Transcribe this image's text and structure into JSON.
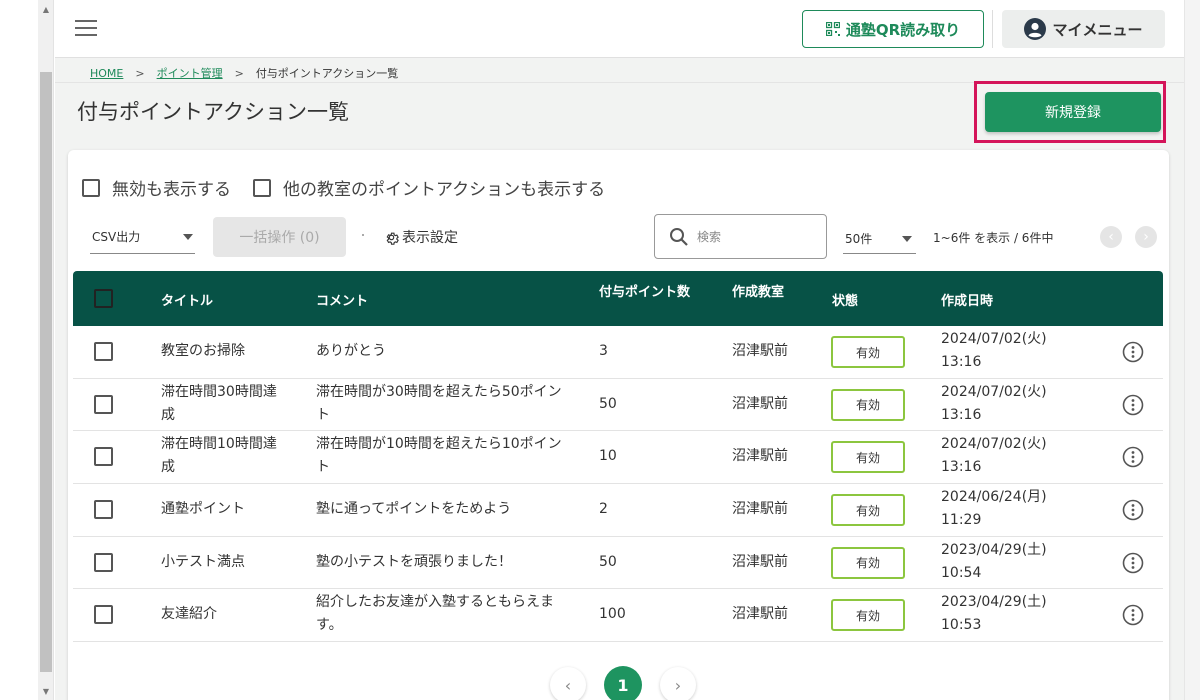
{
  "header": {
    "qr_button": "通塾QR読み取り",
    "mymenu_button": "マイメニュー"
  },
  "breadcrumb": {
    "home": "HOME",
    "sep1": ">",
    "points": "ポイント管理",
    "sep2": ">",
    "current": "付与ポイントアクション一覧"
  },
  "page": {
    "title": "付与ポイントアクション一覧",
    "new_button": "新規登録"
  },
  "filters": {
    "show_disabled": "無効も表示する",
    "show_other_classrooms": "他の教室のポイントアクションも表示する"
  },
  "toolbar": {
    "csv_label": "CSV出力",
    "bulk_label": "一括操作 (0)",
    "display_settings": "表示設定",
    "search_placeholder": "検索",
    "perpage": "50件",
    "count_text": "1~6件 を表示 / 6件中"
  },
  "table": {
    "headers": {
      "title": "タイトル",
      "comment": "コメント",
      "points": "付与ポイント数",
      "classroom": "作成教室",
      "status": "状態",
      "created": "作成日時"
    },
    "rows": [
      {
        "title": "教室のお掃除",
        "comment": "ありがとう",
        "points": "3",
        "classroom": "沼津駅前",
        "status": "有効",
        "date": "2024/07/02(火)",
        "time": "13:16"
      },
      {
        "title": "滞在時間30時間達成",
        "comment": "滞在時間が30時間を超えたら50ポイント",
        "points": "50",
        "classroom": "沼津駅前",
        "status": "有効",
        "date": "2024/07/02(火)",
        "time": "13:16"
      },
      {
        "title": "滞在時間10時間達成",
        "comment": "滞在時間が10時間を超えたら10ポイント",
        "points": "10",
        "classroom": "沼津駅前",
        "status": "有効",
        "date": "2024/07/02(火)",
        "time": "13:16"
      },
      {
        "title": "通塾ポイント",
        "comment": "塾に通ってポイントをためよう",
        "points": "2",
        "classroom": "沼津駅前",
        "status": "有効",
        "date": "2024/06/24(月)",
        "time": "11:29"
      },
      {
        "title": "小テスト満点",
        "comment": "塾の小テストを頑張りました！",
        "points": "50",
        "classroom": "沼津駅前",
        "status": "有効",
        "date": "2023/04/29(土)",
        "time": "10:54"
      },
      {
        "title": "友達紹介",
        "comment": "紹介したお友達が入塾するともらえます。",
        "points": "100",
        "classroom": "沼津駅前",
        "status": "有効",
        "date": "2023/04/29(土)",
        "time": "10:53"
      }
    ]
  },
  "pagination": {
    "current": "1"
  },
  "colors": {
    "primary": "#1e9460",
    "header_bg": "#075246",
    "highlight": "#d4145a",
    "status_border": "#8cc63f"
  }
}
